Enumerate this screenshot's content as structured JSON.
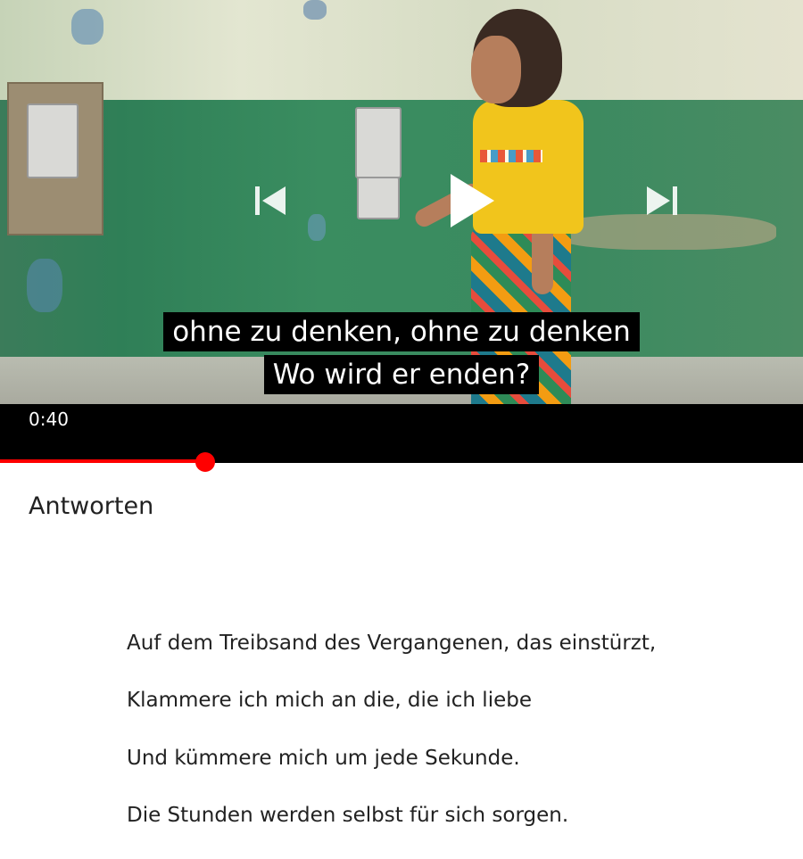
{
  "player": {
    "subtitle_lines": [
      "ohne zu denken, ohne zu denken",
      "Wo wird er enden?"
    ],
    "current_time": "0:40",
    "progress_fraction": 0.255,
    "accent_color": "#ff0000",
    "controls": {
      "previous_icon": "skip-previous-icon",
      "play_icon": "play-icon",
      "next_icon": "skip-next-icon"
    }
  },
  "content": {
    "heading": "Antworten",
    "lyrics": [
      "Auf dem Treibsand des Vergangenen, das einstürzt,",
      "Klammere ich mich an die, die ich liebe",
      "Und kümmere mich um jede Sekunde.",
      "Die Stunden werden selbst für sich sorgen."
    ]
  }
}
